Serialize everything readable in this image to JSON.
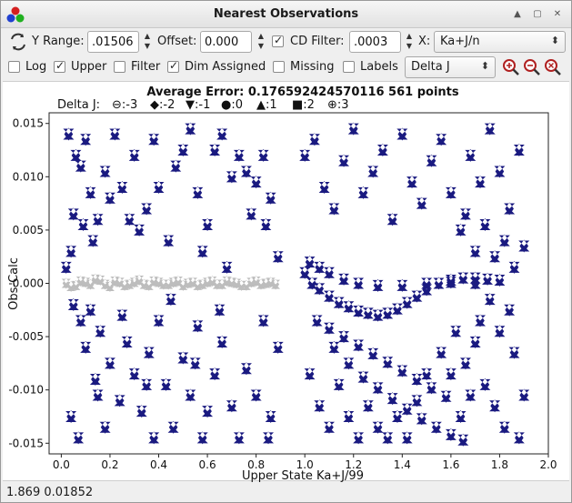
{
  "window": {
    "title": "Nearest Observations"
  },
  "toolbar": {
    "y_range_label": "Y Range:",
    "y_range_value": ".01506",
    "offset_label": "Offset:",
    "offset_value": "0.000",
    "cd_filter_label": "CD Filter:",
    "cd_filter_value": ".0003",
    "x_label": "X:",
    "x_value": "Ka+J/n",
    "cd_filter_checked": true
  },
  "options": {
    "log": {
      "label": "Log",
      "checked": false
    },
    "upper": {
      "label": "Upper",
      "checked": true
    },
    "filter": {
      "label": "Filter",
      "checked": false
    },
    "dim_assigned": {
      "label": "Dim Assigned",
      "checked": true
    },
    "missing": {
      "label": "Missing",
      "checked": false
    },
    "labels": {
      "label": "Labels",
      "checked": false
    },
    "delta_select": "Delta J"
  },
  "icons": [
    "app-icon",
    "refresh-icon",
    "zoom-in-icon",
    "zoom-out-icon",
    "zoom-reset-icon",
    "minimize-icon",
    "maximize-icon",
    "close-icon"
  ],
  "chart_data": {
    "type": "scatter",
    "title": "Average Error: 0.176592424570116  561 points",
    "xlabel": "Upper State Ka+J/99",
    "ylabel": "Obs-Calc",
    "xlim": [
      -0.05,
      2.0
    ],
    "ylim": [
      -0.016,
      0.016
    ],
    "xticks": [
      "0.0",
      "0.2",
      "0.4",
      "0.6",
      "0.8",
      "1.0",
      "1.2",
      "1.4",
      "1.6",
      "1.8",
      "2.0"
    ],
    "yticks": [
      "0.015",
      "0.010",
      "0.005",
      "-0.000",
      "-0.005",
      "-0.010",
      "-0.015"
    ],
    "legend": {
      "title": "Delta J:",
      "entries": [
        {
          "symbol": "⊖",
          "label": ":-3"
        },
        {
          "symbol": "◆",
          "label": ":-2"
        },
        {
          "symbol": "▼",
          "label": ":-1"
        },
        {
          "symbol": "●",
          "label": ":0"
        },
        {
          "symbol": "▲",
          "label": ":1"
        },
        {
          "symbol": "■",
          "label": ":2"
        },
        {
          "symbol": "⊕",
          "label": ":3"
        }
      ]
    },
    "series": [
      {
        "name": "assigned",
        "color": "#1a1a80",
        "values": [
          [
            0.03,
            0.014
          ],
          [
            0.06,
            0.012
          ],
          [
            0.08,
            0.011
          ],
          [
            0.1,
            0.0135
          ],
          [
            0.12,
            0.0085
          ],
          [
            0.05,
            0.0065
          ],
          [
            0.09,
            0.0055
          ],
          [
            0.04,
            0.003
          ],
          [
            0.02,
            0.0015
          ],
          [
            0.13,
            0.004
          ],
          [
            0.15,
            0.006
          ],
          [
            0.18,
            0.0105
          ],
          [
            0.2,
            0.008
          ],
          [
            0.22,
            0.014
          ],
          [
            0.25,
            0.009
          ],
          [
            0.28,
            0.006
          ],
          [
            0.3,
            0.012
          ],
          [
            0.32,
            0.005
          ],
          [
            0.35,
            0.007
          ],
          [
            0.38,
            0.0135
          ],
          [
            0.4,
            0.009
          ],
          [
            0.44,
            0.004
          ],
          [
            0.47,
            0.011
          ],
          [
            0.5,
            0.0125
          ],
          [
            0.53,
            0.0145
          ],
          [
            0.56,
            0.0085
          ],
          [
            0.58,
            0.003
          ],
          [
            0.6,
            0.0055
          ],
          [
            0.63,
            0.0125
          ],
          [
            0.66,
            0.014
          ],
          [
            0.7,
            0.01
          ],
          [
            0.73,
            0.012
          ],
          [
            0.76,
            0.0105
          ],
          [
            0.78,
            0.0065
          ],
          [
            0.8,
            0.0095
          ],
          [
            0.83,
            0.012
          ],
          [
            0.86,
            0.008
          ],
          [
            0.89,
            0.0025
          ],
          [
            0.84,
            0.0055
          ],
          [
            0.68,
            0.0015
          ],
          [
            0.05,
            -0.002
          ],
          [
            0.08,
            -0.0035
          ],
          [
            0.1,
            -0.006
          ],
          [
            0.12,
            -0.0025
          ],
          [
            0.14,
            -0.009
          ],
          [
            0.16,
            -0.0045
          ],
          [
            0.2,
            -0.0075
          ],
          [
            0.24,
            -0.011
          ],
          [
            0.27,
            -0.0055
          ],
          [
            0.3,
            -0.0085
          ],
          [
            0.33,
            -0.012
          ],
          [
            0.36,
            -0.0065
          ],
          [
            0.4,
            -0.0035
          ],
          [
            0.43,
            -0.0095
          ],
          [
            0.46,
            -0.0135
          ],
          [
            0.5,
            -0.007
          ],
          [
            0.53,
            -0.0105
          ],
          [
            0.56,
            -0.004
          ],
          [
            0.6,
            -0.012
          ],
          [
            0.63,
            -0.0085
          ],
          [
            0.66,
            -0.0055
          ],
          [
            0.7,
            -0.0115
          ],
          [
            0.73,
            -0.0145
          ],
          [
            0.76,
            -0.008
          ],
          [
            0.8,
            -0.0105
          ],
          [
            0.83,
            -0.0035
          ],
          [
            0.86,
            -0.0125
          ],
          [
            0.89,
            -0.006
          ],
          [
            0.04,
            -0.0125
          ],
          [
            0.07,
            -0.0145
          ],
          [
            0.18,
            -0.0135
          ],
          [
            0.38,
            -0.0145
          ],
          [
            0.58,
            -0.0145
          ],
          [
            0.25,
            -0.003
          ],
          [
            0.45,
            -0.0015
          ],
          [
            0.65,
            -0.0025
          ],
          [
            0.15,
            -0.0105
          ],
          [
            0.35,
            -0.0095
          ],
          [
            0.55,
            -0.0075
          ],
          [
            0.85,
            -0.0145
          ],
          [
            1.0,
            0.001
          ],
          [
            1.03,
            0.0
          ],
          [
            1.06,
            -0.0005
          ],
          [
            1.1,
            -0.0012
          ],
          [
            1.14,
            -0.0018
          ],
          [
            1.18,
            -0.0022
          ],
          [
            1.22,
            -0.0026
          ],
          [
            1.26,
            -0.0028
          ],
          [
            1.3,
            -0.003
          ],
          [
            1.34,
            -0.0028
          ],
          [
            1.38,
            -0.0024
          ],
          [
            1.42,
            -0.0018
          ],
          [
            1.46,
            -0.0012
          ],
          [
            1.5,
            -0.0006
          ],
          [
            1.55,
            0.0
          ],
          [
            1.6,
            0.0003
          ],
          [
            1.65,
            0.0005
          ],
          [
            1.7,
            0.0005
          ],
          [
            1.75,
            0.0004
          ],
          [
            1.8,
            0.0003
          ],
          [
            1.02,
            0.002
          ],
          [
            1.06,
            0.0015
          ],
          [
            1.1,
            0.001
          ],
          [
            1.16,
            0.0004
          ],
          [
            1.22,
            0.0
          ],
          [
            1.3,
            -0.0002
          ],
          [
            1.4,
            -0.0002
          ],
          [
            1.5,
            0.0
          ],
          [
            1.6,
            0.0001
          ],
          [
            1.7,
            0.0
          ],
          [
            1.12,
            -0.006
          ],
          [
            1.18,
            -0.0075
          ],
          [
            1.24,
            -0.0088
          ],
          [
            1.3,
            -0.0098
          ],
          [
            1.36,
            -0.0108
          ],
          [
            1.42,
            -0.0118
          ],
          [
            1.48,
            -0.0127
          ],
          [
            1.54,
            -0.0135
          ],
          [
            1.6,
            -0.0142
          ],
          [
            1.65,
            -0.0147
          ],
          [
            1.05,
            -0.0035
          ],
          [
            1.1,
            -0.0042
          ],
          [
            1.16,
            -0.005
          ],
          [
            1.22,
            -0.0058
          ],
          [
            1.28,
            -0.0066
          ],
          [
            1.34,
            -0.0074
          ],
          [
            1.4,
            -0.0082
          ],
          [
            1.46,
            -0.009
          ],
          [
            1.52,
            -0.0098
          ],
          [
            1.58,
            -0.0106
          ],
          [
            1.0,
            0.012
          ],
          [
            1.04,
            0.0135
          ],
          [
            1.08,
            0.009
          ],
          [
            1.12,
            0.007
          ],
          [
            1.16,
            0.0115
          ],
          [
            1.2,
            0.0145
          ],
          [
            1.24,
            0.0085
          ],
          [
            1.28,
            0.0105
          ],
          [
            1.32,
            0.0125
          ],
          [
            1.36,
            0.006
          ],
          [
            1.4,
            0.014
          ],
          [
            1.44,
            0.0095
          ],
          [
            1.48,
            0.0075
          ],
          [
            1.52,
            0.0115
          ],
          [
            1.56,
            0.0135
          ],
          [
            1.6,
            0.0085
          ],
          [
            1.64,
            0.005
          ],
          [
            1.68,
            0.012
          ],
          [
            1.72,
            0.0095
          ],
          [
            1.76,
            0.0145
          ],
          [
            1.8,
            0.0105
          ],
          [
            1.84,
            0.007
          ],
          [
            1.88,
            0.0125
          ],
          [
            1.9,
            0.0035
          ],
          [
            1.86,
            0.0015
          ],
          [
            1.82,
            0.004
          ],
          [
            1.78,
            0.0025
          ],
          [
            1.74,
            0.0055
          ],
          [
            1.7,
            0.003
          ],
          [
            1.66,
            0.0065
          ],
          [
            1.02,
            -0.0085
          ],
          [
            1.06,
            -0.0115
          ],
          [
            1.1,
            -0.0135
          ],
          [
            1.14,
            -0.0095
          ],
          [
            1.18,
            -0.0125
          ],
          [
            1.22,
            -0.0145
          ],
          [
            1.26,
            -0.0115
          ],
          [
            1.3,
            -0.0135
          ],
          [
            1.34,
            -0.0145
          ],
          [
            1.38,
            -0.0125
          ],
          [
            1.42,
            -0.0145
          ],
          [
            1.46,
            -0.011
          ],
          [
            1.5,
            -0.0085
          ],
          [
            1.56,
            -0.0065
          ],
          [
            1.62,
            -0.0045
          ],
          [
            1.66,
            -0.0075
          ],
          [
            1.7,
            -0.0055
          ],
          [
            1.74,
            -0.0095
          ],
          [
            1.78,
            -0.0115
          ],
          [
            1.82,
            -0.0135
          ],
          [
            1.86,
            -0.0065
          ],
          [
            1.9,
            -0.0105
          ],
          [
            1.88,
            -0.0145
          ],
          [
            1.84,
            -0.0025
          ],
          [
            1.8,
            -0.0045
          ],
          [
            1.76,
            -0.0015
          ],
          [
            1.72,
            -0.0035
          ],
          [
            1.68,
            -0.0105
          ],
          [
            1.64,
            -0.0125
          ],
          [
            1.6,
            -0.0085
          ]
        ]
      },
      {
        "name": "dimmed",
        "color": "#bdbdbd",
        "values": [
          [
            0.02,
            0.0
          ],
          [
            0.06,
            -0.0002
          ],
          [
            0.1,
            0.0001
          ],
          [
            0.14,
            0.0004
          ],
          [
            0.18,
            -0.0001
          ],
          [
            0.22,
            0.0002
          ],
          [
            0.26,
            -0.0002
          ],
          [
            0.3,
            0.0001
          ],
          [
            0.34,
            -0.0001
          ],
          [
            0.38,
            0.0002
          ],
          [
            0.42,
            -0.0001
          ],
          [
            0.46,
            0.0001
          ],
          [
            0.5,
            -0.0002
          ],
          [
            0.54,
            0.0001
          ],
          [
            0.58,
            -0.0001
          ],
          [
            0.62,
            0.0002
          ],
          [
            0.66,
            -0.0001
          ],
          [
            0.7,
            0.0001
          ],
          [
            0.74,
            -0.0002
          ],
          [
            0.78,
            0.0001
          ],
          [
            0.82,
            -0.0001
          ],
          [
            0.86,
            0.0001
          ],
          [
            0.04,
            -0.0003
          ],
          [
            0.08,
            0.0002
          ],
          [
            0.12,
            -0.0001
          ],
          [
            0.16,
            0.0003
          ],
          [
            0.2,
            -0.0003
          ],
          [
            0.24,
            0.0001
          ],
          [
            0.28,
            -0.0001
          ],
          [
            0.32,
            0.0003
          ],
          [
            0.36,
            -0.0002
          ],
          [
            0.4,
            0.0001
          ],
          [
            0.44,
            -0.0001
          ],
          [
            0.48,
            0.0002
          ],
          [
            0.52,
            0.0
          ],
          [
            0.56,
            -0.0002
          ],
          [
            0.6,
            0.0001
          ],
          [
            0.64,
            -0.0001
          ],
          [
            0.68,
            0.0002
          ],
          [
            0.72,
            0.0
          ],
          [
            0.76,
            -0.0002
          ],
          [
            0.8,
            0.0002
          ],
          [
            0.84,
            0.0
          ],
          [
            0.88,
            -0.0001
          ]
        ]
      }
    ]
  },
  "status": {
    "coords": "1.869  0.01852"
  }
}
